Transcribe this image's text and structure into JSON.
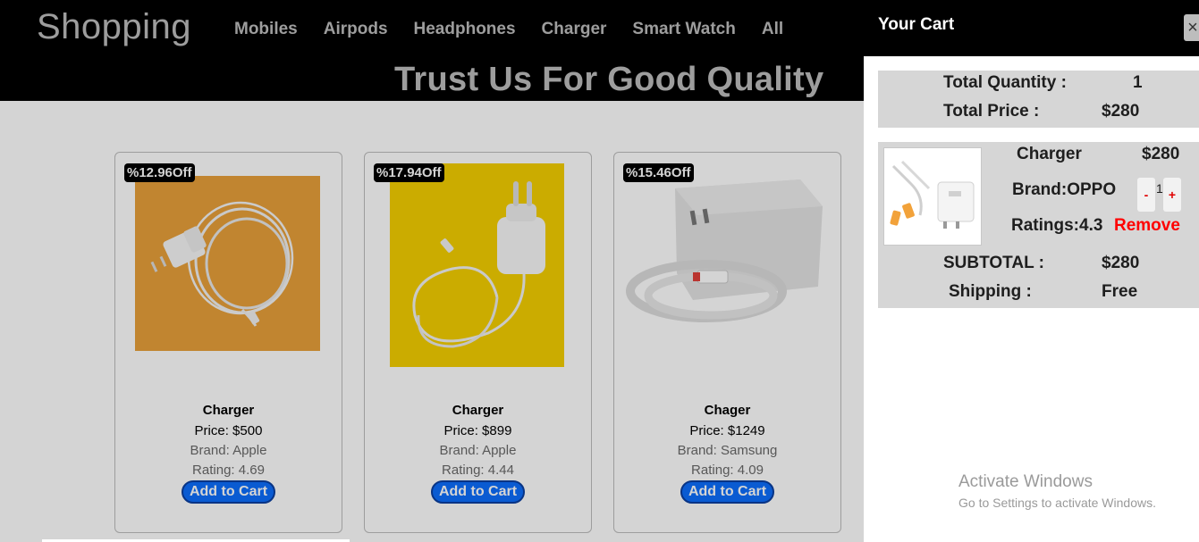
{
  "header": {
    "brand": "Shopping",
    "nav": [
      "Mobiles",
      "Airpods",
      "Headphones",
      "Charger",
      "Smart Watch",
      "All"
    ],
    "tagline": "Trust Us For Good Quality"
  },
  "products": [
    {
      "badge": "%12.96Off",
      "name": "Charger",
      "price": "Price: $500",
      "brand": "Brand: Apple",
      "rating": "Rating: 4.69",
      "button": "Add to Cart",
      "image_bg": "#e69a34"
    },
    {
      "badge": "%17.94Off",
      "name": "Charger",
      "price": "Price: $899",
      "brand": "Brand: Apple",
      "rating": "Rating: 4.44",
      "button": "Add to Cart",
      "image_bg": "#f4cf00"
    },
    {
      "badge": "%15.46Off",
      "name": "Chager",
      "price": "Price: $1249",
      "brand": "Brand: Samsung",
      "rating": "Rating: 4.09",
      "button": "Add to Cart",
      "image_bg": "#ffffff"
    }
  ],
  "cart": {
    "title": "Your Cart",
    "close_icon": "×",
    "total_quantity_label": "Total Quantity :",
    "total_quantity_value": "1",
    "total_price_label": "Total Price :",
    "total_price_value": "$280",
    "item": {
      "name": "Charger",
      "price": "$280",
      "brand": "Brand:OPPO",
      "rating": "Ratings:4.3",
      "qty_minus": "-",
      "qty": "1",
      "qty_plus": "+",
      "remove": "Remove",
      "subtotal_label": "SUBTOTAL :",
      "subtotal_value": "$280",
      "shipping_label": "Shipping :",
      "shipping_value": "Free"
    }
  },
  "watermark": {
    "title": "Activate Windows",
    "subtitle": "Go to Settings to activate Windows."
  },
  "colors": {
    "header_bg": "#000000",
    "accent_button": "#0d6efd",
    "remove": "#ff0000",
    "cart_box": "#d6d6d6"
  }
}
